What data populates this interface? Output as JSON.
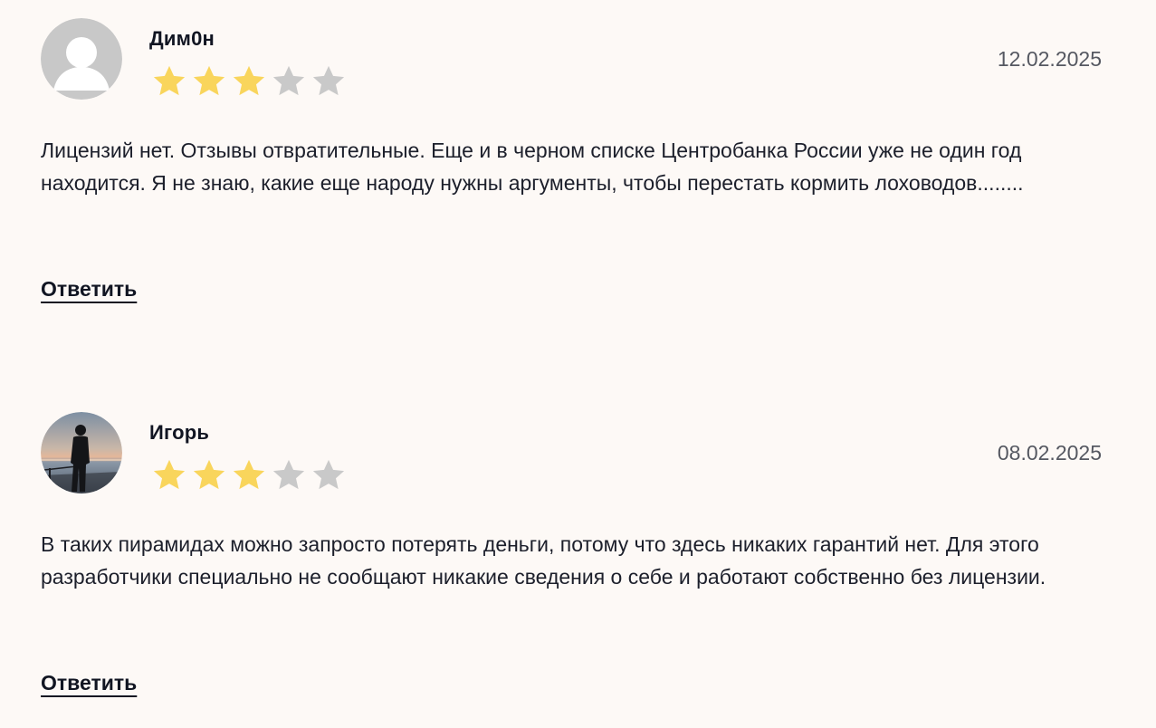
{
  "colors": {
    "background": "#fdf9f6",
    "star_filled": "#f9d55c",
    "star_empty": "#c9c9c9",
    "text": "#1c1f2b",
    "date": "#555861"
  },
  "reviews": [
    {
      "author": "Дим0н",
      "avatar": "default-avatar-icon",
      "rating": 3,
      "rating_max": 5,
      "date": "12.02.2025",
      "text": "Лицензий нет. Отзывы отвратительные. Еще и в черном списке Центробанка России уже не один год находится. Я не знаю, какие еще народу нужны аргументы, чтобы перестать кормить лоховодов........",
      "reply_label": "Ответить"
    },
    {
      "author": "Игорь",
      "avatar": "user-photo",
      "rating": 3,
      "rating_max": 5,
      "date": "08.02.2025",
      "text": "В таких пирамидах можно запросто потерять деньги, потому что здесь никаких гарантий нет. Для этого разработчики специально не сообщают никакие сведения о себе и работают собственно без лицензии.",
      "reply_label": "Ответить"
    }
  ]
}
